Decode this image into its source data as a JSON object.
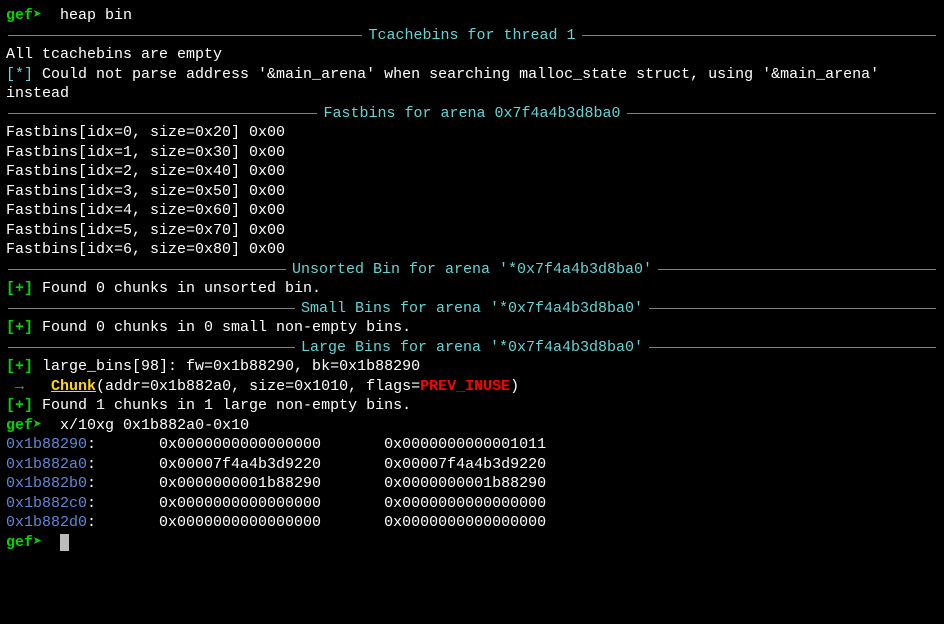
{
  "prompt": "gef➤  ",
  "cmd1": "heap bin",
  "sections": {
    "tcache": "Tcachebins for thread 1",
    "fastbins": "Fastbins for arena 0x7f4a4b3d8ba0",
    "unsorted": "Unsorted Bin for arena '*0x7f4a4b3d8ba0'",
    "small": "Small Bins for arena '*0x7f4a4b3d8ba0'",
    "large": "Large Bins for arena '*0x7f4a4b3d8ba0'"
  },
  "tcache_empty": "All tcachebins are empty",
  "warn_marker": "[*]",
  "warn_text": " Could not parse address '&main_arena' when searching malloc_state struct, using '&main_arena' instead",
  "fastbins": [
    "Fastbins[idx=0, size=0x20] 0x00",
    "Fastbins[idx=1, size=0x30] 0x00",
    "Fastbins[idx=2, size=0x40] 0x00",
    "Fastbins[idx=3, size=0x50] 0x00",
    "Fastbins[idx=4, size=0x60] 0x00",
    "Fastbins[idx=5, size=0x70] 0x00",
    "Fastbins[idx=6, size=0x80] 0x00"
  ],
  "plus_marker": "[+]",
  "unsorted_found": " Found 0 chunks in unsorted bin.",
  "small_found": " Found 0 chunks in 0 small non-empty bins.",
  "large_bins_line": " large_bins[98]: fw=0x1b88290, bk=0x1b88290",
  "chunk": {
    "arrow": " →   ",
    "label": "Chunk",
    "args1": "(addr=0x1b882a0, size=0x1010, flags=",
    "flag": "PREV_INUSE",
    "args2": ")"
  },
  "large_found": " Found 1 chunks in 1 large non-empty bins.",
  "cmd2": "x/10xg 0x1b882a0-0x10",
  "mem": [
    {
      "addr": "0x1b88290",
      "c1": "0x0000000000000000",
      "c2": "0x0000000000001011"
    },
    {
      "addr": "0x1b882a0",
      "c1": "0x00007f4a4b3d9220",
      "c2": "0x00007f4a4b3d9220"
    },
    {
      "addr": "0x1b882b0",
      "c1": "0x0000000001b88290",
      "c2": "0x0000000001b88290"
    },
    {
      "addr": "0x1b882c0",
      "c1": "0x0000000000000000",
      "c2": "0x0000000000000000"
    },
    {
      "addr": "0x1b882d0",
      "c1": "0x0000000000000000",
      "c2": "0x0000000000000000"
    }
  ]
}
